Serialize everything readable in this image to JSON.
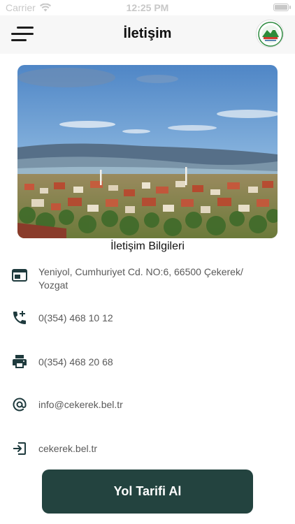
{
  "status_bar": {
    "carrier": "Carrier",
    "time": "12:25 PM"
  },
  "header": {
    "title": "İletişim"
  },
  "section": {
    "title": "İletişim Bilgileri"
  },
  "contact": {
    "address": "Yeniyol, Cumhuriyet Cd. NO:6, 66500 Çekerek/ Yozgat",
    "phone": "0(354) 468 10 12",
    "fax": "0(354) 468 20 68",
    "email": "info@cekerek.bel.tr",
    "website": "cekerek.bel.tr"
  },
  "icons": {
    "address": "address-card-icon",
    "phone": "phone-add-icon",
    "fax": "printer-icon",
    "email": "at-sign-icon",
    "website": "login-arrow-icon"
  },
  "actions": {
    "route_label": "Yol Tarifi Al"
  },
  "colors": {
    "accent": "#23433f",
    "nav_background": "#f7f7f7",
    "icon": "#1e3a3d"
  }
}
